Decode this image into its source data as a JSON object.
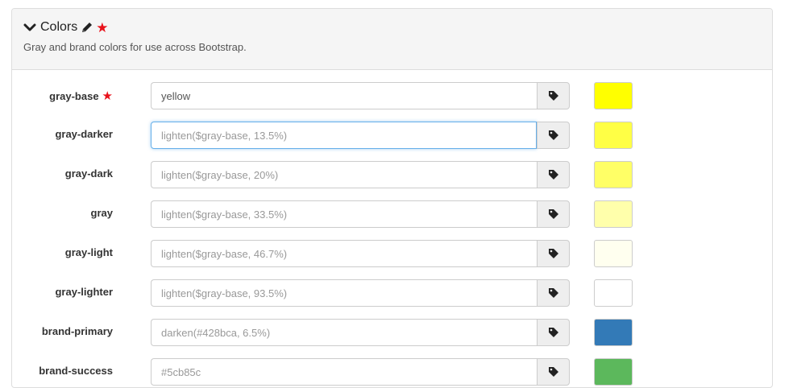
{
  "header": {
    "title": "Colors",
    "subtitle": "Gray and brand colors for use across Bootstrap.",
    "chevron_icon": "chevron-down-icon",
    "edit_icon": "pencil-icon",
    "star_symbol": "★"
  },
  "rows": [
    {
      "label": "gray-base",
      "required_star": "★",
      "value": "yellow",
      "placeholder": "",
      "swatch": "#ffff00",
      "focused": false
    },
    {
      "label": "gray-darker",
      "value": "",
      "placeholder": "lighten($gray-base, 13.5%)",
      "swatch": "#ffff45",
      "focused": true
    },
    {
      "label": "gray-dark",
      "value": "",
      "placeholder": "lighten($gray-base, 20%)",
      "swatch": "#ffff66",
      "focused": false
    },
    {
      "label": "gray",
      "value": "",
      "placeholder": "lighten($gray-base, 33.5%)",
      "swatch": "#ffffab",
      "focused": false
    },
    {
      "label": "gray-light",
      "value": "",
      "placeholder": "lighten($gray-base, 46.7%)",
      "swatch": "#ffffef",
      "focused": false
    },
    {
      "label": "gray-lighter",
      "value": "",
      "placeholder": "lighten($gray-base, 93.5%)",
      "swatch": "#ffffff",
      "focused": false
    },
    {
      "label": "brand-primary",
      "value": "",
      "placeholder": "darken(#428bca, 6.5%)",
      "swatch": "#337ab7",
      "focused": false
    },
    {
      "label": "brand-success",
      "value": "",
      "placeholder": "#5cb85c",
      "swatch": "#5cb85c",
      "focused": false
    }
  ],
  "addon_icon": "tag-icon"
}
